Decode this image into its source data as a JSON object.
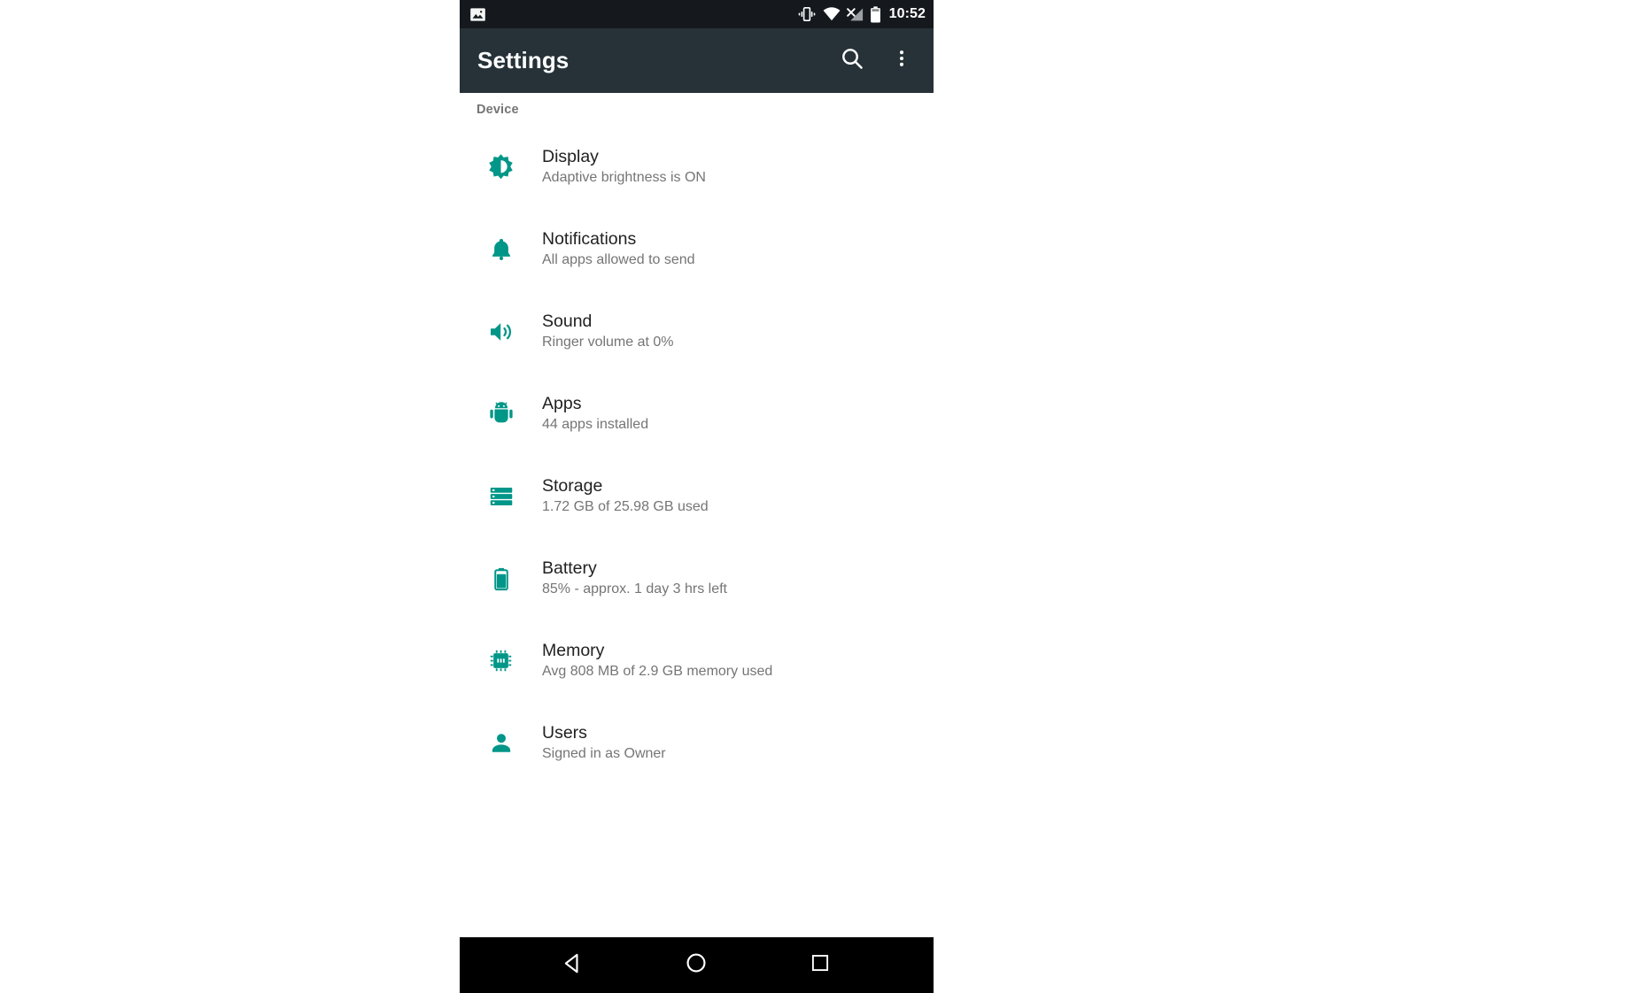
{
  "theme": {
    "status_bar_bg": "#15191d",
    "toolbar_bg": "#263238",
    "accent_teal": "#009688",
    "content_bg": "#ffffff",
    "nav_bar_bg": "#000000",
    "title_text": "#212121",
    "subtitle_text": "#757575",
    "page_bg": "#ffffff"
  },
  "status_bar": {
    "time": "10:52",
    "icons": [
      "screenshot-icon",
      "vibrate-icon",
      "wifi-icon",
      "cellular-off-icon",
      "battery-icon"
    ]
  },
  "toolbar": {
    "title": "Settings",
    "search_label": "Search",
    "overflow_label": "More options"
  },
  "content": {
    "section_header": "Device",
    "items": [
      {
        "icon": "brightness-icon",
        "title": "Display",
        "subtitle": "Adaptive brightness is ON"
      },
      {
        "icon": "bell-icon",
        "title": "Notifications",
        "subtitle": "All apps allowed to send"
      },
      {
        "icon": "volume-icon",
        "title": "Sound",
        "subtitle": "Ringer volume at 0%"
      },
      {
        "icon": "android-robot-icon",
        "title": "Apps",
        "subtitle": "44 apps installed"
      },
      {
        "icon": "storage-icon",
        "title": "Storage",
        "subtitle": "1.72 GB of 25.98 GB used"
      },
      {
        "icon": "battery-icon",
        "title": "Battery",
        "subtitle": "85% - approx. 1 day 3 hrs left"
      },
      {
        "icon": "memory-chip-icon",
        "title": "Memory",
        "subtitle": "Avg 808 MB of 2.9 GB memory used"
      },
      {
        "icon": "person-icon",
        "title": "Users",
        "subtitle": "Signed in as Owner"
      }
    ]
  },
  "nav_bar": {
    "back_label": "Back",
    "home_label": "Home",
    "recents_label": "Recent apps"
  }
}
